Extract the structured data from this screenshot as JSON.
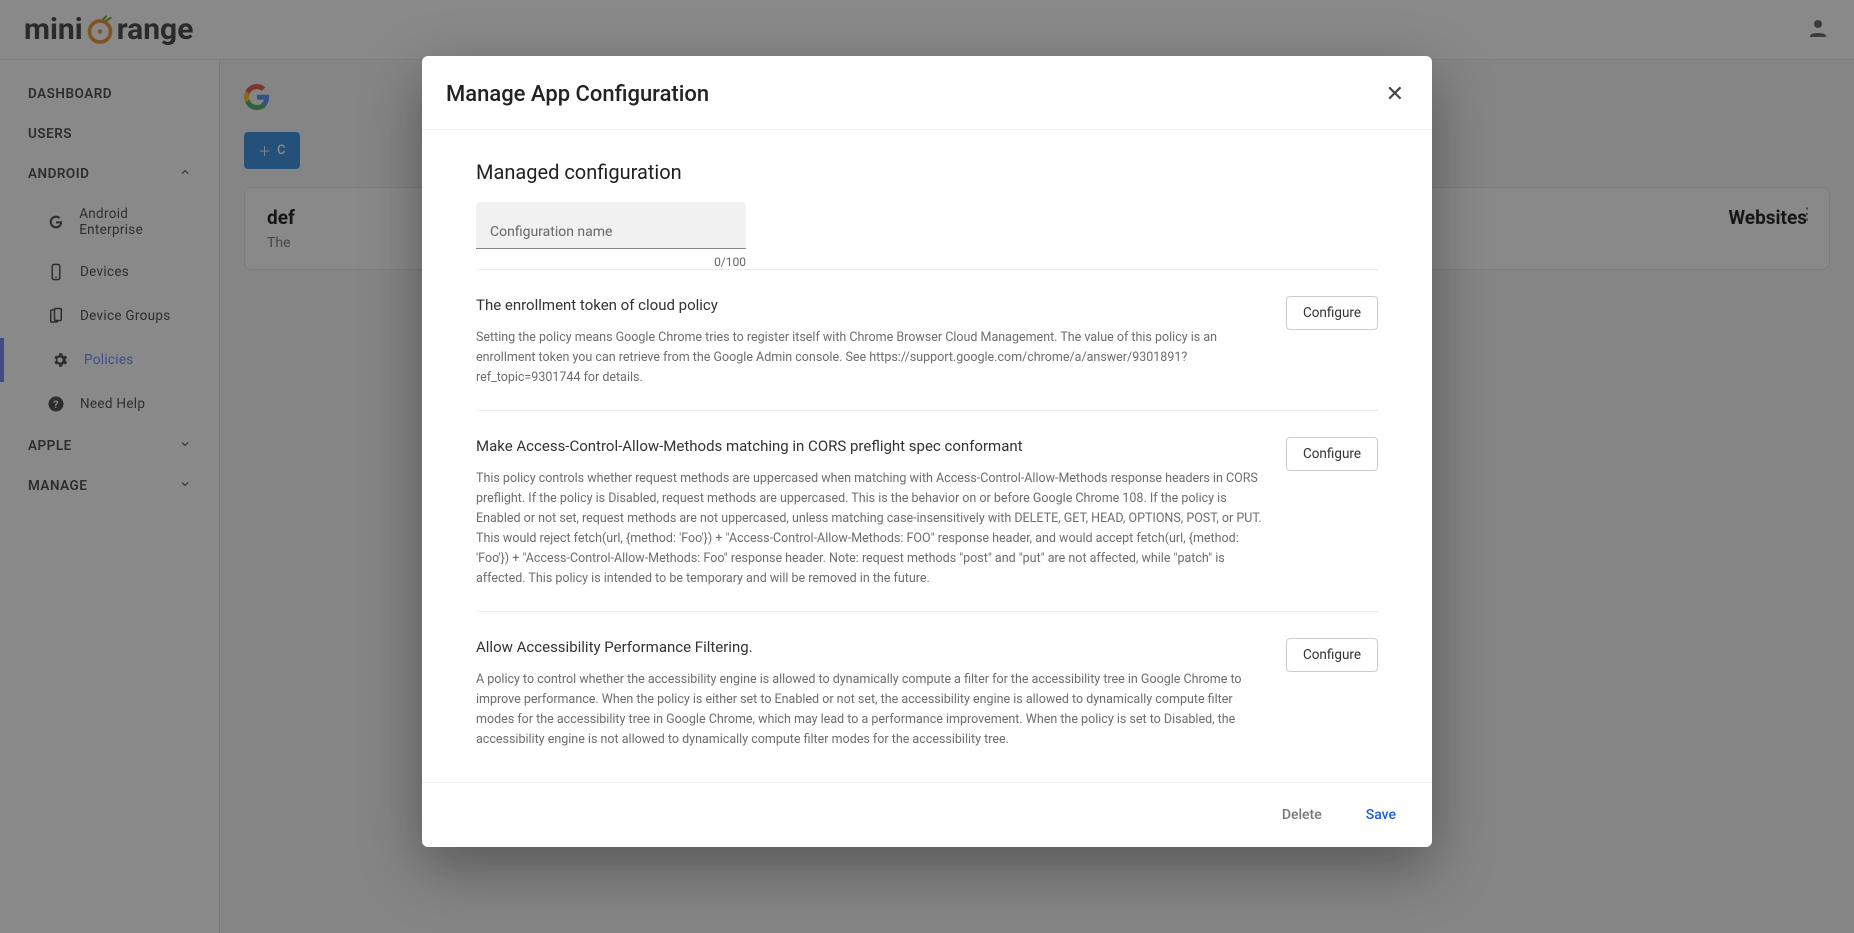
{
  "logo_prefix": "mini",
  "logo_suffix": "range",
  "sidebar": {
    "dashboard": "DASHBOARD",
    "users": "USERS",
    "android": "ANDROID",
    "android_items": {
      "enterprise": "Android Enterprise",
      "devices": "Devices",
      "device_groups": "Device Groups",
      "policies": "Policies",
      "need_help": "Need Help"
    },
    "apple": "APPLE",
    "manage": "MANAGE"
  },
  "main": {
    "add_btn": "C",
    "card1_title": "def",
    "card1_sub": "The",
    "card2_title": "Websites"
  },
  "modal": {
    "title": "Manage App Configuration",
    "section_title": "Managed configuration",
    "config_name_placeholder": "Configuration name",
    "char_count": "0/100",
    "configure_label": "Configure",
    "delete_label": "Delete",
    "save_label": "Save",
    "policies": [
      {
        "title": "The enrollment token of cloud policy",
        "desc": "Setting the policy means Google Chrome tries to register itself with Chrome Browser Cloud Management. The value of this policy is an enrollment token you can retrieve from the Google Admin console. See https://support.google.com/chrome/a/answer/9301891?ref_topic=9301744 for details."
      },
      {
        "title": "Make Access-Control-Allow-Methods matching in CORS preflight spec conformant",
        "desc": "This policy controls whether request methods are uppercased when matching with Access-Control-Allow-Methods response headers in CORS preflight. If the policy is Disabled, request methods are uppercased. This is the behavior on or before Google Chrome 108. If the policy is Enabled or not set, request methods are not uppercased, unless matching case-insensitively with DELETE, GET, HEAD, OPTIONS, POST, or PUT. This would reject fetch(url, {method: 'Foo'}) + \"Access-Control-Allow-Methods: FOO\" response header, and would accept fetch(url, {method: 'Foo'}) + \"Access-Control-Allow-Methods: Foo\" response header. Note: request methods \"post\" and \"put\" are not affected, while \"patch\" is affected. This policy is intended to be temporary and will be removed in the future."
      },
      {
        "title": "Allow Accessibility Performance Filtering.",
        "desc": "A policy to control whether the accessibility engine is allowed to dynamically compute a filter for the accessibility tree in Google Chrome to improve performance. When the policy is either set to Enabled or not set, the accessibility engine is allowed to dynamically compute filter modes for the accessibility tree in Google Chrome, which may lead to a performance improvement. When the policy is set to Disabled, the accessibility engine is not allowed to dynamically compute filter modes for the accessibility tree."
      }
    ]
  }
}
